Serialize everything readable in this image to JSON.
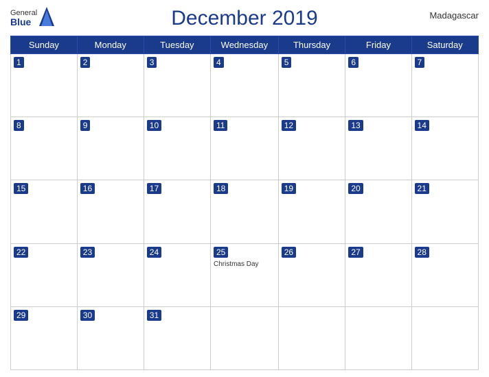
{
  "header": {
    "title": "December 2019",
    "country": "Madagascar",
    "logo": {
      "general": "General",
      "blue": "Blue"
    }
  },
  "weekdays": [
    "Sunday",
    "Monday",
    "Tuesday",
    "Wednesday",
    "Thursday",
    "Friday",
    "Saturday"
  ],
  "weeks": [
    [
      {
        "date": "1",
        "holiday": ""
      },
      {
        "date": "2",
        "holiday": ""
      },
      {
        "date": "3",
        "holiday": ""
      },
      {
        "date": "4",
        "holiday": ""
      },
      {
        "date": "5",
        "holiday": ""
      },
      {
        "date": "6",
        "holiday": ""
      },
      {
        "date": "7",
        "holiday": ""
      }
    ],
    [
      {
        "date": "8",
        "holiday": ""
      },
      {
        "date": "9",
        "holiday": ""
      },
      {
        "date": "10",
        "holiday": ""
      },
      {
        "date": "11",
        "holiday": ""
      },
      {
        "date": "12",
        "holiday": ""
      },
      {
        "date": "13",
        "holiday": ""
      },
      {
        "date": "14",
        "holiday": ""
      }
    ],
    [
      {
        "date": "15",
        "holiday": ""
      },
      {
        "date": "16",
        "holiday": ""
      },
      {
        "date": "17",
        "holiday": ""
      },
      {
        "date": "18",
        "holiday": ""
      },
      {
        "date": "19",
        "holiday": ""
      },
      {
        "date": "20",
        "holiday": ""
      },
      {
        "date": "21",
        "holiday": ""
      }
    ],
    [
      {
        "date": "22",
        "holiday": ""
      },
      {
        "date": "23",
        "holiday": ""
      },
      {
        "date": "24",
        "holiday": ""
      },
      {
        "date": "25",
        "holiday": "Christmas Day"
      },
      {
        "date": "26",
        "holiday": ""
      },
      {
        "date": "27",
        "holiday": ""
      },
      {
        "date": "28",
        "holiday": ""
      }
    ],
    [
      {
        "date": "29",
        "holiday": ""
      },
      {
        "date": "30",
        "holiday": ""
      },
      {
        "date": "31",
        "holiday": ""
      },
      {
        "date": "",
        "holiday": ""
      },
      {
        "date": "",
        "holiday": ""
      },
      {
        "date": "",
        "holiday": ""
      },
      {
        "date": "",
        "holiday": ""
      }
    ]
  ]
}
